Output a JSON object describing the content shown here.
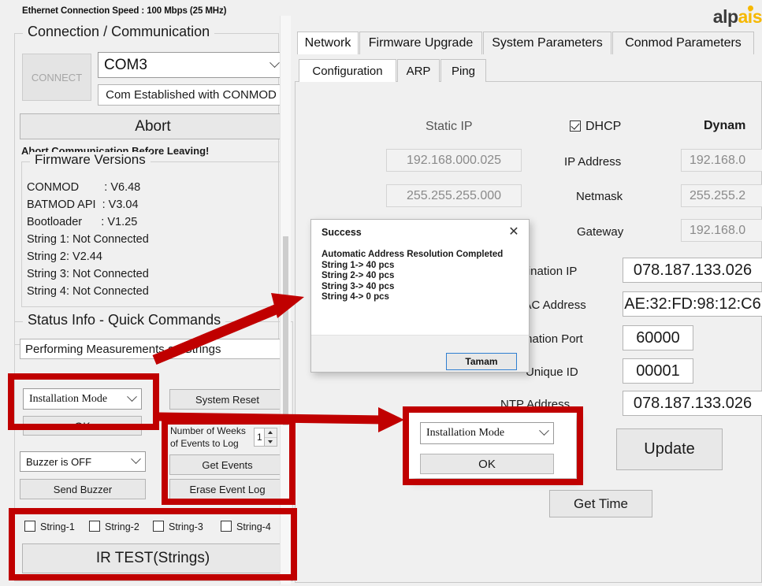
{
  "header": {
    "ethernet_speed": "Ethernet Connection Speed : 100 Mbps (25 MHz)",
    "logo_dark": "alp",
    "logo_gold": "ais"
  },
  "connection_group": {
    "title": "Connection / Communication",
    "connect_button": "CONNECT",
    "port_combo_value": "COM3",
    "com_status": "Com Established with CONMOD",
    "abort_button": "Abort",
    "abort_warning": "Abort Communication Before Leaving!"
  },
  "firmware_group": {
    "title": "Firmware Versions",
    "lines": [
      "CONMOD        : V6.48",
      "BATMOD API  : V3.04",
      "Bootloader      : V1.25",
      "String 1: Not Connected",
      "String 2: V2.44",
      "String 3: Not Connected",
      "String 4: Not Connected"
    ]
  },
  "status_group": {
    "title": "Status Info - Quick Commands",
    "status_text": "Performing Measurements on Strings",
    "mode_combo_value": "Installation Mode",
    "mode_ok_button": "OK",
    "system_reset_button": "System Reset",
    "buzzer_combo_value": "Buzzer is OFF",
    "send_buzzer_button": "Send Buzzer",
    "weeks_label_line1": "Number of Weeks",
    "weeks_label_line2": "of Events to Log",
    "weeks_value": "1",
    "get_events_button": "Get Events",
    "erase_event_log_button": "Erase Event Log",
    "string_checkboxes": [
      {
        "label": "String-1",
        "checked": false
      },
      {
        "label": "String-2",
        "checked": false
      },
      {
        "label": "String-3",
        "checked": false
      },
      {
        "label": "String-4",
        "checked": false
      }
    ],
    "ir_test_button": "IR TEST(Strings)"
  },
  "tabs": {
    "main": [
      {
        "label": "Network",
        "active": true
      },
      {
        "label": "Firmware Upgrade",
        "active": false
      },
      {
        "label": "System Parameters",
        "active": false
      },
      {
        "label": "Conmod Parameters",
        "active": false
      }
    ],
    "sub": [
      {
        "label": "Configuration",
        "active": true
      },
      {
        "label": "ARP",
        "active": false
      },
      {
        "label": "Ping",
        "active": false
      }
    ]
  },
  "network": {
    "static_ip_header": "Static IP",
    "dhcp_label": "DHCP",
    "dhcp_checked": true,
    "dynamic_header": "Dynam",
    "rows": [
      {
        "label": "IP Address",
        "static": "192.168.000.025",
        "dynamic": "192.168.0"
      },
      {
        "label": "Netmask",
        "static": "255.255.255.000",
        "dynamic": "255.255.2"
      },
      {
        "label": "Gateway",
        "static": "",
        "dynamic": "192.168.0"
      }
    ],
    "fields": [
      {
        "label": "Destination IP",
        "value": "078.187.133.026"
      },
      {
        "label": "MAC Address",
        "value": "AE:32:FD:98:12:C6"
      },
      {
        "label": "Destination Port",
        "value": "60000"
      },
      {
        "label": "Unique ID",
        "value": "00001"
      },
      {
        "label": "NTP Address",
        "value": "078.187.133.026"
      }
    ],
    "update_button": "Update",
    "get_time_button": "Get Time"
  },
  "dialog": {
    "title": "Success",
    "close_icon": "✕",
    "body": "Automatic Address Resolution Completed\nString 1-> 40 pcs\nString 2-> 40 pcs\nString 3-> 40 pcs\nString 4-> 0 pcs",
    "ok_button": "Tamam"
  },
  "callout": {
    "mode_combo_value": "Installation Mode",
    "ok_button": "OK"
  },
  "colors": {
    "annotation_red": "#c00000",
    "accent_gold": "#f6b800",
    "dialog_accent": "#2f7fd1"
  }
}
